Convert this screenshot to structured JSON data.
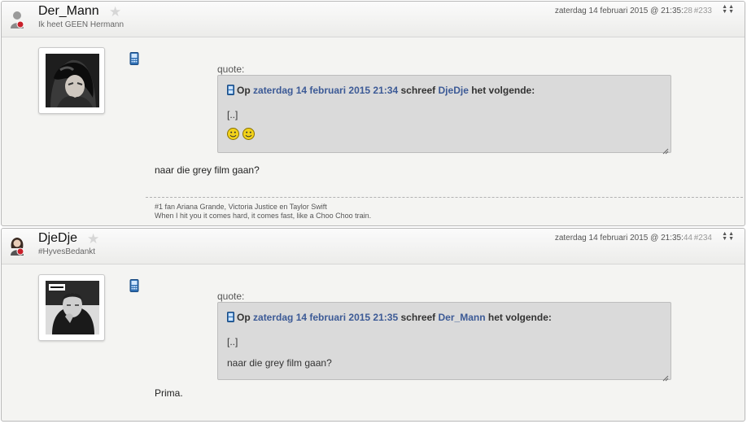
{
  "posts": [
    {
      "username": "Der_Mann",
      "tagline": "Ik heet GEEN Hermann",
      "timestamp_main": "zaterdag 14 februari 2015 @ 21:35:",
      "timestamp_secs": "28",
      "post_number": "#233",
      "user_icon": "user-female-icon",
      "quote": {
        "label": "quote:",
        "prefix": "Op",
        "date": "zaterdag 14 februari 2015 21:34",
        "middle": "schreef",
        "author": "DjeDje",
        "suffix": "het volgende:",
        "ellipsis": "[..]",
        "smileys": [
          "smiley-icon",
          "smiley-icon"
        ]
      },
      "body": "naar die grey film gaan?",
      "signature": [
        "#1 fan Ariana Grande, Victoria Justice en Taylor Swift",
        "When I hit you it comes hard, it comes fast, like a Choo Choo train."
      ]
    },
    {
      "username": "DjeDje",
      "tagline": "#HyvesBedankt",
      "timestamp_main": "zaterdag 14 februari 2015 @ 21:35:",
      "timestamp_secs": "44",
      "post_number": "#234",
      "user_icon": "user-female-icon",
      "quote": {
        "label": "quote:",
        "prefix": "Op",
        "date": "zaterdag 14 februari 2015 21:35",
        "middle": "schreef",
        "author": "Der_Mann",
        "suffix": "het volgende:",
        "ellipsis": "[..]",
        "body": "naar die grey film gaan?"
      },
      "body": "Prima."
    }
  ],
  "colors": {
    "link": "#3c5a96",
    "quote_bg": "#dadada",
    "post_bg": "#f4f4f2",
    "star": "#d6d6d6"
  }
}
